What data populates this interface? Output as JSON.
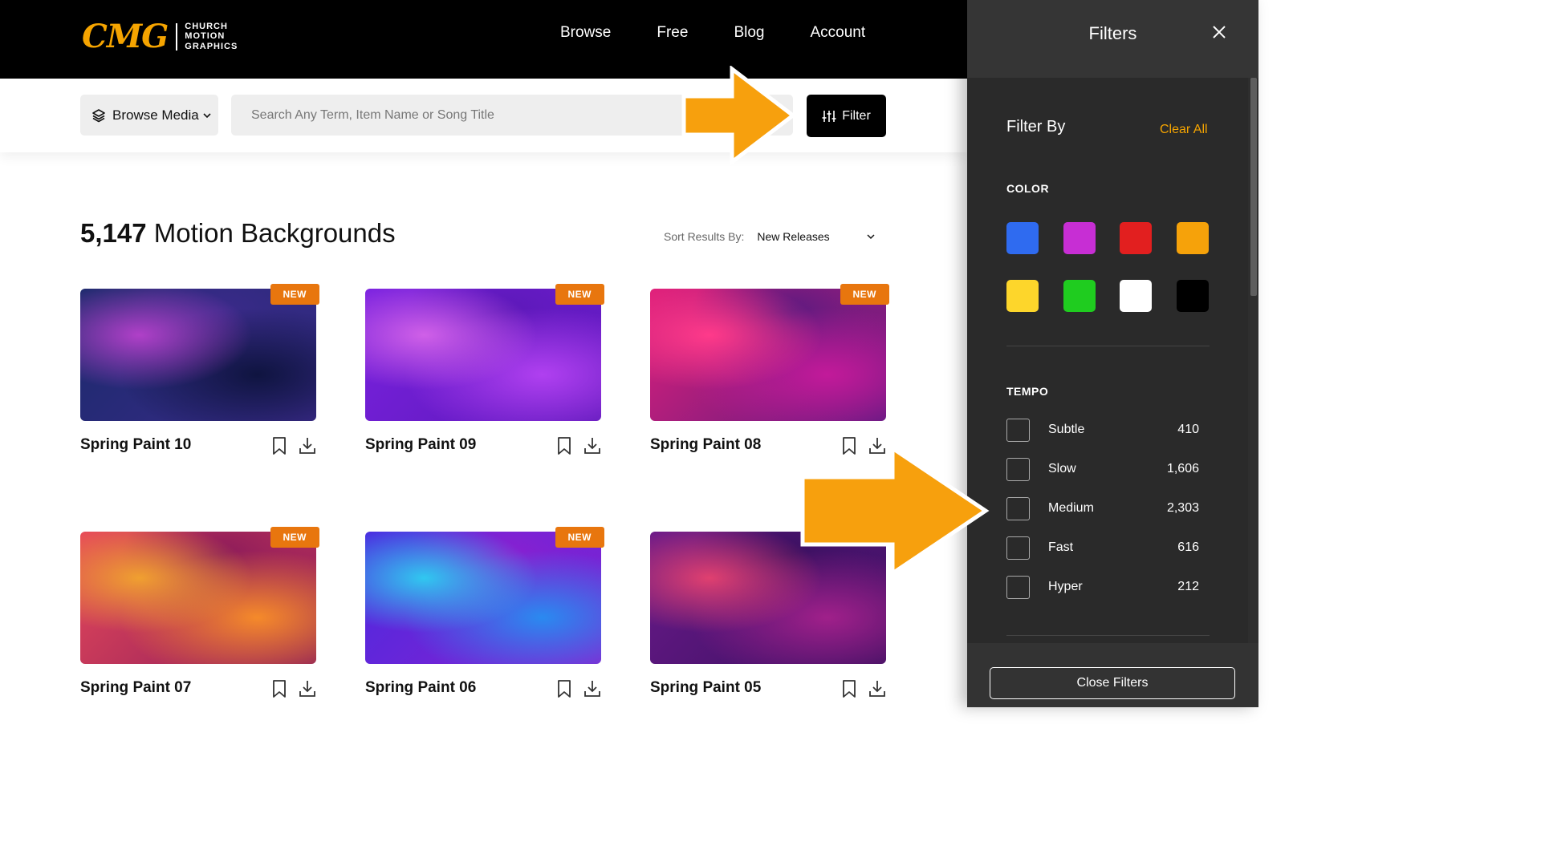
{
  "header": {
    "logo_mark": "CMG",
    "logo_text": [
      "CHURCH",
      "MOTION",
      "GRAPHICS"
    ],
    "nav": [
      "Browse",
      "Free",
      "Blog",
      "Account"
    ]
  },
  "toolbar": {
    "browse_label": "Browse Media",
    "search_placeholder": "Search Any Term, Item Name or Song Title",
    "filter_label": "Filter"
  },
  "results": {
    "count": "5,147",
    "label": "Motion Backgrounds",
    "sort_label": "Sort Results By:",
    "sort_value": "New Releases"
  },
  "cards": [
    {
      "title": "Spring Paint 10",
      "badge": "NEW",
      "colors": [
        "#1a2a6b",
        "#0f1440",
        "#3b2a8a",
        "#b040c8"
      ]
    },
    {
      "title": "Spring Paint 09",
      "badge": "NEW",
      "colors": [
        "#7a22e0",
        "#b040f0",
        "#5c18b8",
        "#d060e8"
      ]
    },
    {
      "title": "Spring Paint 08",
      "badge": "NEW",
      "colors": [
        "#e0207a",
        "#c21a9a",
        "#5a1a80",
        "#ff3a8a"
      ]
    },
    {
      "title": "Spring Paint 07",
      "badge": "NEW",
      "colors": [
        "#e84a5a",
        "#f58a2a",
        "#8a1a5a",
        "#f0a030"
      ]
    },
    {
      "title": "Spring Paint 06",
      "badge": "NEW",
      "colors": [
        "#4a2ae0",
        "#2a8af0",
        "#8a20d0",
        "#30c8f0"
      ]
    },
    {
      "title": "Spring Paint 05",
      "badge": "",
      "colors": [
        "#6a1a8a",
        "#a0208a",
        "#3a1060",
        "#e04070"
      ]
    }
  ],
  "panel": {
    "title": "Filters",
    "filter_by": "Filter By",
    "clear_all": "Clear All",
    "color_label": "COLOR",
    "colors": [
      {
        "name": "blue",
        "hex": "#2f6bf0"
      },
      {
        "name": "purple",
        "hex": "#c72ed4"
      },
      {
        "name": "red",
        "hex": "#e21f1f"
      },
      {
        "name": "orange",
        "hex": "#f6a20a"
      },
      {
        "name": "yellow",
        "hex": "#fdd62b"
      },
      {
        "name": "green",
        "hex": "#1fcc1f"
      },
      {
        "name": "white",
        "hex": "#ffffff"
      },
      {
        "name": "black",
        "hex": "#000000"
      }
    ],
    "tempo_label": "TEMPO",
    "tempo": [
      {
        "name": "Subtle",
        "count": "410"
      },
      {
        "name": "Slow",
        "count": "1,606"
      },
      {
        "name": "Medium",
        "count": "2,303"
      },
      {
        "name": "Fast",
        "count": "616"
      },
      {
        "name": "Hyper",
        "count": "212"
      }
    ],
    "close_filters": "Close Filters"
  },
  "accent": {
    "orange": "#f7a00d",
    "badge": "#e8760e"
  }
}
